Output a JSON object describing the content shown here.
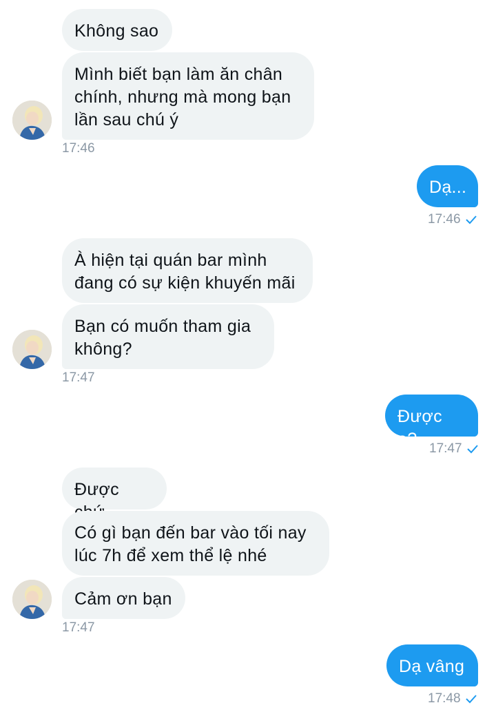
{
  "conversation": {
    "group1": {
      "msg1": "Không sao",
      "msg2": "Mình biết bạn làm ăn chân\nchính, nhưng mà mong bạn\nlần sau chú ý",
      "time": "17:46"
    },
    "reply1": {
      "text": "Dạ...",
      "time": "17:46"
    },
    "group2": {
      "msg1": "À hiện tại quán bar mình\nđang có sự kiện khuyến mãi",
      "msg2": "Bạn có muốn tham gia\nkhông?",
      "time": "17:47"
    },
    "reply2": {
      "text": "Được ạ?",
      "time": "17:47"
    },
    "group3": {
      "msg1": "Được chứ",
      "msg2": "Có gì bạn đến bar vào tối nay\nlúc 7h để xem thể lệ nhé",
      "msg3": "Cảm ơn bạn",
      "time": "17:47"
    },
    "reply3": {
      "text": "Dạ vâng",
      "time": "17:48"
    }
  },
  "colors": {
    "incoming_bg": "#eff3f4",
    "outgoing_bg": "#1d9bf0",
    "time_text": "#8b98a5",
    "seen_check": "#1d9bf0"
  },
  "icons": {
    "read_receipt": "checkmark-icon"
  }
}
